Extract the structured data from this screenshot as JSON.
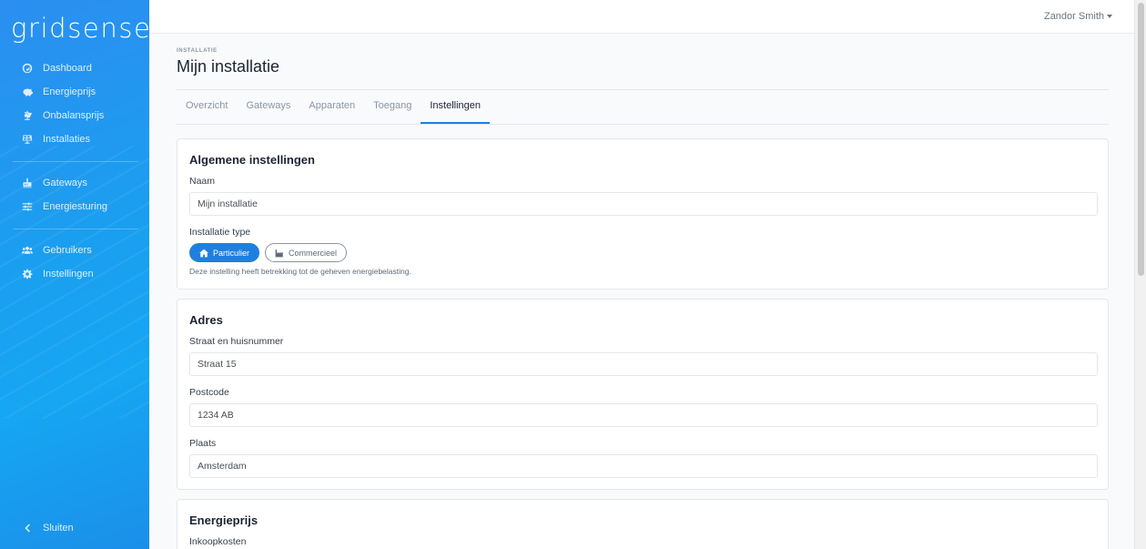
{
  "brand": "gridsense",
  "user": {
    "name": "Zandor Smith"
  },
  "sidebar": {
    "groups": [
      [
        {
          "label": "Dashboard",
          "icon": "dashboard-icon"
        },
        {
          "label": "Energieprijs",
          "icon": "piggy-bank-icon"
        },
        {
          "label": "Onbalansprijs",
          "icon": "balance-scale-icon"
        },
        {
          "label": "Installaties",
          "icon": "solar-panel-icon"
        }
      ],
      [
        {
          "label": "Gateways",
          "icon": "gateway-icon"
        },
        {
          "label": "Energiesturing",
          "icon": "sliders-icon"
        }
      ],
      [
        {
          "label": "Gebruikers",
          "icon": "users-icon"
        },
        {
          "label": "Instellingen",
          "icon": "gear-icon"
        }
      ]
    ],
    "close_label": "Sluiten"
  },
  "page": {
    "pretitle": "INSTALLATIE",
    "title": "Mijn installatie",
    "tabs": [
      "Overzicht",
      "Gateways",
      "Apparaten",
      "Toegang",
      "Instellingen"
    ],
    "active_tab": "Instellingen"
  },
  "general": {
    "title": "Algemene instellingen",
    "name_label": "Naam",
    "name_value": "Mijn installatie",
    "type_label": "Installatie type",
    "type_options": [
      "Particulier",
      "Commercieel"
    ],
    "type_selected": "Particulier",
    "type_help": "Deze instelling heeft betrekking tot de geheven energiebelasting."
  },
  "address": {
    "title": "Adres",
    "street_label": "Straat en huisnummer",
    "street_value": "Straat 15",
    "postcode_label": "Postcode",
    "postcode_value": "1234 AB",
    "city_label": "Plaats",
    "city_value": "Amsterdam"
  },
  "energy_price": {
    "title": "Energieprijs",
    "purchase_label": "Inkoopkosten"
  },
  "colors": {
    "accent": "#1f7fe0",
    "sidebar": "#1a9ff0"
  }
}
